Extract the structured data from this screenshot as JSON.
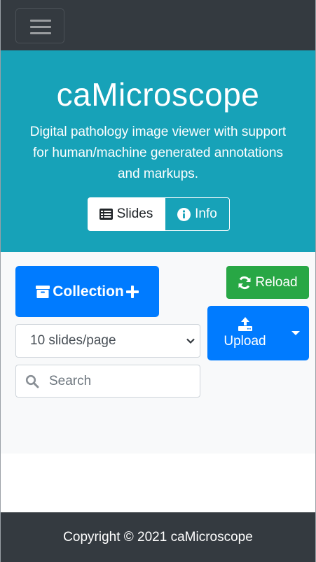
{
  "navbar": {
    "toggle_icon": "hamburger-icon"
  },
  "hero": {
    "title": "caMicroscope",
    "description": "Digital pathology image viewer with support for human/machine generated annotations and markups.",
    "buttons": [
      {
        "label": "Slides",
        "icon": "list-icon"
      },
      {
        "label": "Info",
        "icon": "info-icon"
      }
    ]
  },
  "toolbar": {
    "collection_label": "Collection",
    "reload_label": "Reload",
    "upload_label": "Upload",
    "page_size": {
      "selected": "10 slides/page"
    },
    "search": {
      "placeholder": "Search",
      "value": ""
    }
  },
  "footer": {
    "text": "Copyright © 2021 caMicroscope"
  },
  "colors": {
    "navbar": "#343a40",
    "hero": "#17a2b8",
    "primary": "#007bff",
    "success": "#28a745",
    "main_bg": "#f8f9fa"
  }
}
